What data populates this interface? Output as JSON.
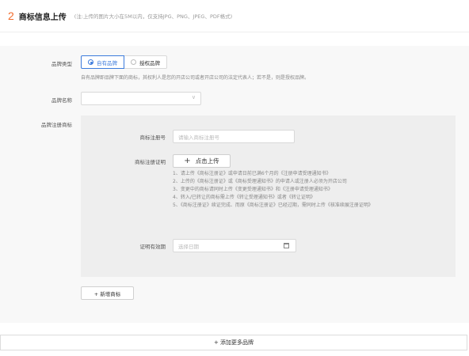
{
  "header": {
    "step": "2",
    "title": "商标信息上传",
    "note": "(注:上传的图片大小在5M以内，仅支持JPG、PNG、JPEG、PDF格式)"
  },
  "brand_type": {
    "label": "品牌类型",
    "options": [
      "自有品牌",
      "授权品牌"
    ],
    "selected": "自有品牌",
    "hint": "自有品牌即品牌下面的商标，其权利人是您的开店公司或者开店公司的法定代表人；若不是，则是授权品牌。"
  },
  "brand_name": {
    "label": "品牌名称",
    "value": ""
  },
  "trademark": {
    "label": "品牌注册商标",
    "reg_no_label": "商标注册号",
    "reg_no_placeholder": "请输入商标注册号",
    "cert_label": "商标注册证明",
    "upload_label": "点击上传",
    "notes": [
      "1、请上传《商标注册证》或申请日前已满6个月的《注册申请受理通知书》",
      "2、上传的《商标注册证》或《商标受理通知书》的申请人或注册人必须为开店公司",
      "3、变更中的商标请同时上传《变更受理通知书》和《注册申请受理通知书》",
      "4、转入/已转让的商标需上传《转让受理通知书》或者《转让证明》",
      "5、《商标注册证》续证完成、而原《商标注册证》已经过期，需同时上传《核准续展注册证明》"
    ],
    "validity_label": "证明有效期",
    "validity_placeholder": "选择日期"
  },
  "actions": {
    "add_trademark": "+ 新增商标",
    "add_brand": "+ 添加更多品牌"
  },
  "colors": {
    "accent": "#3c7bdc",
    "step": "#f26b2c"
  }
}
